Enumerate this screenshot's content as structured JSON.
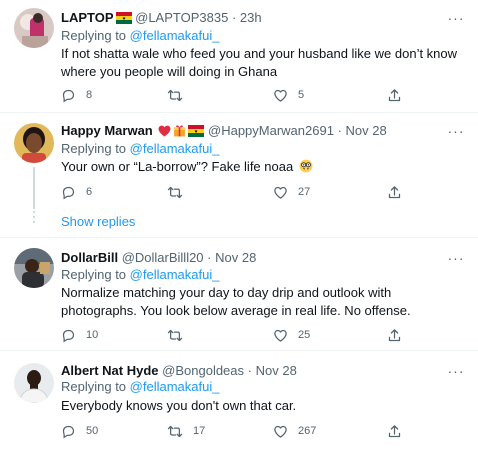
{
  "tweets": [
    {
      "name": "LAPTOP",
      "handle": "@LAPTOP3835",
      "sep": "·",
      "time": "23h",
      "replying_prefix": "Replying to ",
      "replying_to": "@fellamakafui_",
      "text": "If not shatta wale who feed you and your husband like we don’t know where you people will doing in Ghana",
      "replies": "8",
      "retweets": "",
      "likes": "5"
    },
    {
      "name": "Happy Marwan",
      "handle": "@HappyMarwan2691",
      "sep": "·",
      "time": "Nov 28",
      "replying_prefix": "Replying to ",
      "replying_to": "@fellamakafui_",
      "text": "Your own or “La-borrow”? Fake life noaa",
      "replies": "6",
      "retweets": "",
      "likes": "27",
      "show_replies": "Show replies"
    },
    {
      "name": "DollarBill",
      "handle": "@DollarBilll20",
      "sep": "·",
      "time": "Nov 28",
      "replying_prefix": "Replying to ",
      "replying_to": "@fellamakafui_",
      "text": "Normalize matching your day to day drip and outlook with photographs. You look below average in real life. No offense.",
      "replies": "10",
      "retweets": "",
      "likes": "25"
    },
    {
      "name": "Albert Nat Hyde",
      "handle": "@Bongoldeas",
      "sep": "·",
      "time": "Nov 28",
      "replying_prefix": "Replying to ",
      "replying_to": "@fellamakafui_",
      "text": "Everybody knows you don't own that car.",
      "replies": "50",
      "retweets": "17",
      "likes": "267"
    }
  ],
  "more_glyph": "···",
  "colors": {
    "accent": "#1d9bf0",
    "muted": "#536471",
    "text": "#0f1419",
    "divider": "#eff3f4",
    "thread_line": "#cfd9de"
  },
  "icons": [
    "reply-icon",
    "retweet-icon",
    "like-icon",
    "share-icon",
    "ghana-flag-icon",
    "heart-emoji-icon",
    "gift-emoji-icon",
    "nerd-face-emoji-icon"
  ]
}
